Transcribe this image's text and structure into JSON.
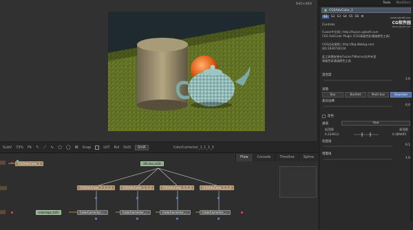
{
  "viewer": {
    "resolution": "640×480"
  },
  "viewer_toolbar": {
    "subv": "SubV",
    "zoom": "73%",
    "fit": "Fit",
    "snap": "Snap",
    "lut": "LUT",
    "roi": "RoI",
    "dod": "DoD",
    "node_label": "ColorCorrector_1_1_1_3"
  },
  "flow": {
    "tabs": [
      "Flow",
      "Console",
      "Timeline",
      "Spline"
    ],
    "nodes": {
      "top_left": "CGSAdvColor_1",
      "text_top": "3D_tea_(LD)",
      "adv1": "CGSAdvColor_1_1_1_1",
      "adv2": "CGSAdvColor_1_1_2",
      "adv3": "CGSAdvColor_1_1_3",
      "adv4": "CGSAdvColor_1_1_4",
      "color_tga": "color.tga_(LD)",
      "cc1": "ColorCorrector_...",
      "cc2": "ColorCorrector_...",
      "cc3": "ColorCorrector_...",
      "cc4": "ColorCorrector_..."
    }
  },
  "inspector": {
    "tabs": [
      "Tools",
      "Modifiers"
    ],
    "tool_name": "CGSAdvColor_1",
    "subtabs": [
      "S1",
      "S2",
      "S3",
      "S4",
      "S5",
      "S6"
    ],
    "logo": {
      "site": "www.cgtsoft.com",
      "name": "CG软件园",
      "sub": "www.cgtsoft.com"
    },
    "controls_label": "Controls",
    "info_lines": [
      "Fusion中文网 | http://fusion.cgtsoft.com",
      "CGS AdvColor Plugin (CGS高级色彩通道颜色工具)",
      "",
      "CGS运动视频 | http://tbq.dbblog.com",
      "QQ:1830744124",
      "",
      "此工具需安装在Fusion7\\Macros文件夹里",
      "高级色彩通道颜色工具"
    ],
    "mix_label": "混合度",
    "mix_value": "1.0",
    "filter_label": "滤镜",
    "filters": [
      "Box",
      "Bartlett",
      "Multi-box",
      "Gaussian"
    ],
    "blur_label": "柔化边缘",
    "blur_value": "0.0",
    "alpha_label": "反色",
    "channel_label": "通道",
    "channel_value": "Hue",
    "low_label": "低范围",
    "high_label": "高范围",
    "low_value": "0.234413",
    "high_value": "0.389495",
    "softness_label": "软度值",
    "softness_value": "0.1",
    "gain_label": "增量值",
    "gain_value": "1.0"
  }
}
